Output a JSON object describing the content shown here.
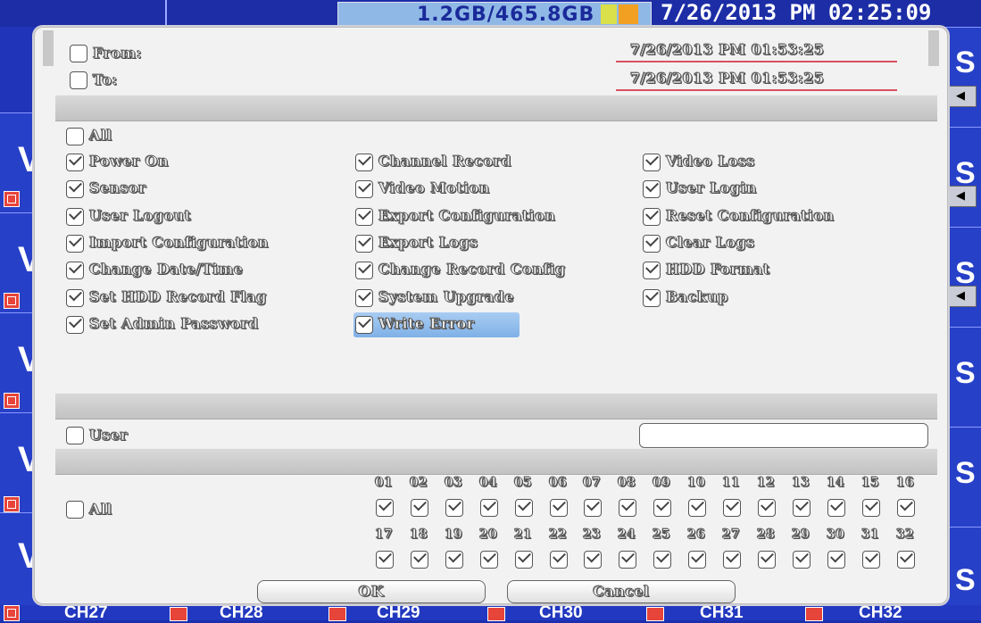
{
  "topbar": {
    "left_label": "",
    "hdd_usage": "1.2GB/465.8GB",
    "clock_prefix": "",
    "clock": "7/26/2013 PM 02:25:09"
  },
  "dialog": {
    "from_label": "From:",
    "from_value": "7/26/2013 PM 01:53:25",
    "to_label": "To:",
    "to_value": "7/26/2013 PM 01:53:25",
    "events_all_label": "All",
    "events": [
      {
        "label": "Power On",
        "checked": true
      },
      {
        "label": "Sensor",
        "checked": true
      },
      {
        "label": "User Logout",
        "checked": true
      },
      {
        "label": "Import Configuration",
        "checked": true
      },
      {
        "label": "Change Date/Time",
        "checked": true
      },
      {
        "label": "Set HDD Record Flag",
        "checked": true
      },
      {
        "label": "Set Admin Password",
        "checked": true
      },
      {
        "label": "Channel Record",
        "checked": true
      },
      {
        "label": "Video Motion",
        "checked": true
      },
      {
        "label": "Export Configuration",
        "checked": true
      },
      {
        "label": "Export Logs",
        "checked": true
      },
      {
        "label": "Change Record Config",
        "checked": true
      },
      {
        "label": "System Upgrade",
        "checked": true
      },
      {
        "label": "Write Error",
        "checked": true,
        "highlighted": true
      },
      {
        "label": "Video Loss",
        "checked": true
      },
      {
        "label": "User Login",
        "checked": true
      },
      {
        "label": "Reset Configuration",
        "checked": true
      },
      {
        "label": "Clear Logs",
        "checked": true
      },
      {
        "label": "HDD Format",
        "checked": true
      },
      {
        "label": "Backup",
        "checked": true
      }
    ],
    "user_label": "User",
    "user_value": "",
    "channels_all_label": "All",
    "channels_row1": [
      "01",
      "02",
      "03",
      "04",
      "05",
      "06",
      "07",
      "08",
      "09",
      "10",
      "11",
      "12",
      "13",
      "14",
      "15",
      "16"
    ],
    "channels_row2": [
      "17",
      "18",
      "19",
      "20",
      "21",
      "22",
      "23",
      "24",
      "25",
      "26",
      "27",
      "28",
      "29",
      "30",
      "31",
      "32"
    ],
    "ok_label": "OK",
    "cancel_label": "Cancel"
  },
  "background": {
    "channel_labels": [
      "CH27",
      "CH28",
      "CH29",
      "CH30",
      "CH31",
      "CH32"
    ],
    "tile_letter_left": "V",
    "tile_letter_right": "S"
  },
  "colors": {
    "screen_blue": "#1f34b8",
    "dialog_bg": "#f2f2f2",
    "section_bar": "#c8c8c8",
    "date_underline": "#d85060",
    "highlight": "#8fbcee"
  },
  "icons": {
    "checkbox_checked": "check-mark",
    "camera": "film-icon",
    "speaker": "speaker-icon"
  }
}
